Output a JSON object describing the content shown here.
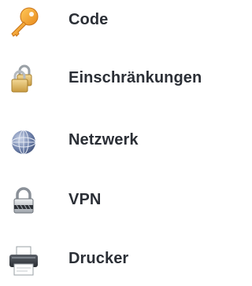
{
  "menu": {
    "items": [
      {
        "label": "Code",
        "icon": "key-icon"
      },
      {
        "label": "Einschränkungen",
        "icon": "padlocks-icon"
      },
      {
        "label": "Netzwerk",
        "icon": "globe-icon"
      },
      {
        "label": "VPN",
        "icon": "vpn-lock-icon"
      },
      {
        "label": "Drucker",
        "icon": "printer-icon"
      }
    ]
  },
  "colors": {
    "label_text": "#2b2f36",
    "background": "#ffffff",
    "key_orange": "#f5a623",
    "lock_gold": "#d9b25a",
    "globe_blue": "#4a5e8c"
  }
}
